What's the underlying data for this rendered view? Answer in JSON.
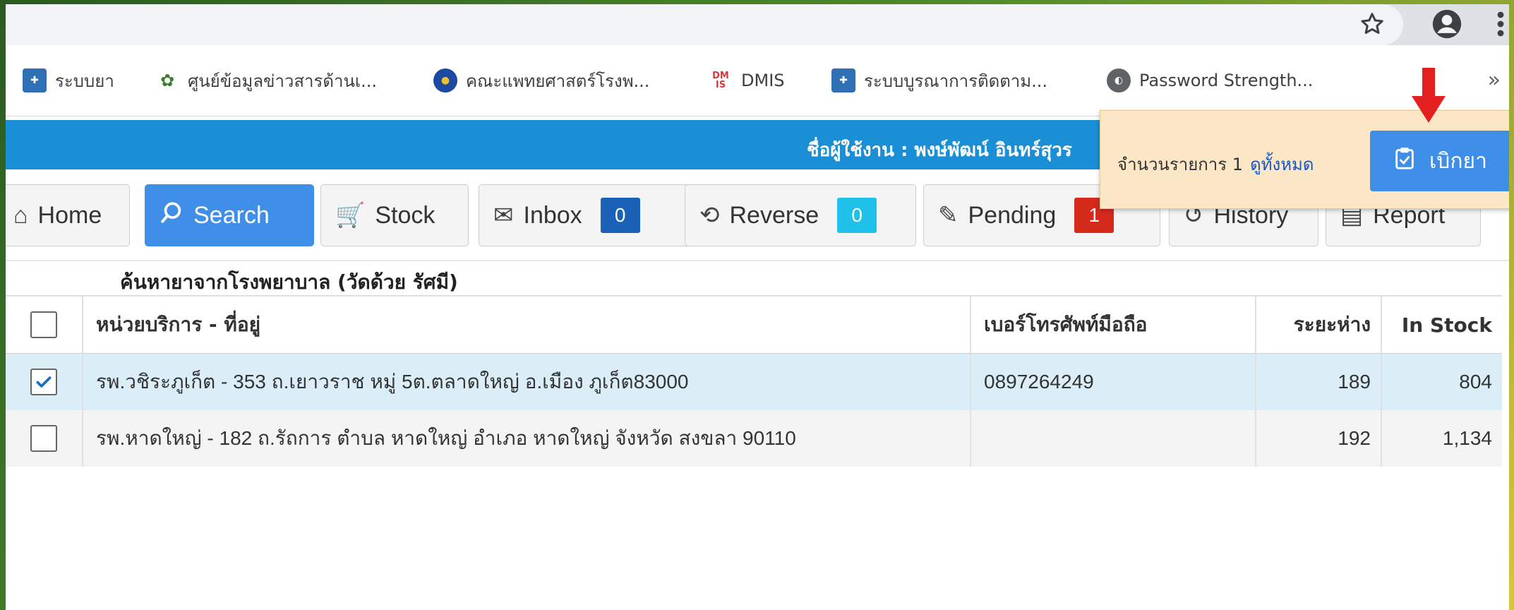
{
  "browser": {
    "bookmarks": [
      {
        "label": "ระบบยา",
        "icon": "hospital-icon",
        "color": "#2f6fb5"
      },
      {
        "label": "ศูนย์ข้อมูลข่าวสารด้านเ...",
        "icon": "globe-leaf-icon",
        "color": "#3b7d2f"
      },
      {
        "label": "คณะแพทยศาสตร์โรงพ...",
        "icon": "emblem-icon",
        "color": "#1d4aa0"
      },
      {
        "label": "DMIS",
        "icon": "dmis-icon",
        "color": "#d83a3a"
      },
      {
        "label": "ระบบบูรณาการติดตาม...",
        "icon": "hospital-cross-icon",
        "color": "#2f6fb5"
      },
      {
        "label": "Password Strength...",
        "icon": "globe-icon",
        "color": "#5f6368"
      }
    ],
    "bookmarks_more": "»",
    "dmis_icon_text": "DM\nIS"
  },
  "header": {
    "user_label": "ชื่อผู้ใช้งาน : พงษ์พัฒน์ อินทร์สุวร"
  },
  "toolbar": {
    "home": "Home",
    "search": "Search",
    "stock": "Stock",
    "inbox": "Inbox",
    "inbox_count": "0",
    "reverse": "Reverse",
    "reverse_count": "0",
    "pending": "Pending",
    "pending_count": "1",
    "history": "History",
    "report": "Report"
  },
  "colors": {
    "blue_badge": "#1a62b8",
    "cyan_badge": "#1fc0ea",
    "red_badge": "#d42a1c",
    "header_bar": "#1a8fd6",
    "active_button": "#3f8ee8"
  },
  "main": {
    "section_title": "ค้นหายาจากโรงพยาบาล (วัดด้วย รัศมี)",
    "columns": [
      "หน่วยบริการ - ที่อยู่",
      "เบอร์โทรศัพท์มือถือ",
      "ระยะห่าง",
      "In Stock"
    ],
    "rows": [
      {
        "checked": true,
        "unit": "รพ.วชิระภูเก็ต - 353 ถ.เยาวราช หมู่ 5ต.ตลาดใหญ่ อ.เมือง ภูเก็ต83000",
        "phone": "0897264249",
        "distance": "189",
        "stock": "804"
      },
      {
        "checked": false,
        "unit": "รพ.หาดใหญ่ - 182 ถ.รัถการ ตำบล หาดใหญ่ อำเภอ หาดใหญ่ จังหวัด สงขลา 90110",
        "phone": "",
        "distance": "192",
        "stock": "1,134"
      }
    ]
  },
  "popup": {
    "count_text": "จำนวนรายการ 1",
    "view_all": "ดูทั้งหมด",
    "button": "เบิกยา"
  }
}
